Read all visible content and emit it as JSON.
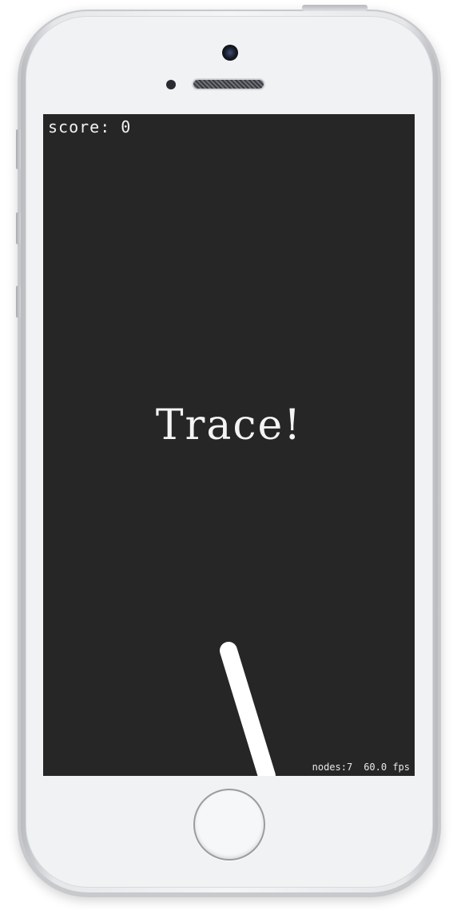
{
  "hud": {
    "score_label": "score: 0"
  },
  "game": {
    "title": "Trace!"
  },
  "debug": {
    "nodes": "nodes:7",
    "fps": "60.0 fps"
  },
  "colors": {
    "background": "#262626",
    "foreground": "#ffffff"
  },
  "icons": {
    "home": "home-button",
    "camera": "front-camera",
    "speaker": "earpiece-speaker"
  }
}
